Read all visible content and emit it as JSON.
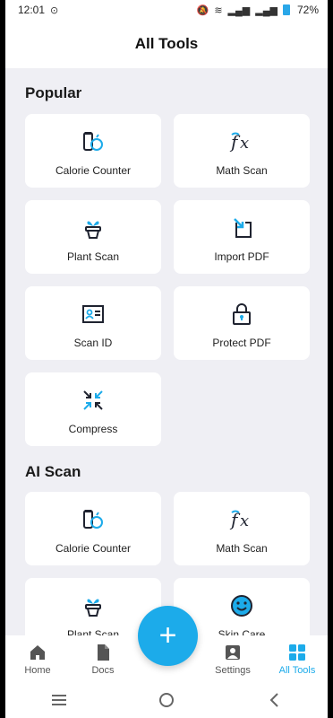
{
  "status": {
    "time": "12:01",
    "battery": "72%"
  },
  "header": {
    "title": "All Tools"
  },
  "sections": [
    {
      "title": "Popular",
      "items": [
        {
          "label": "Calorie Counter",
          "icon": "calorie-icon"
        },
        {
          "label": "Math Scan",
          "icon": "fx-icon"
        },
        {
          "label": "Plant Scan",
          "icon": "plant-icon"
        },
        {
          "label": "Import PDF",
          "icon": "import-icon"
        },
        {
          "label": "Scan ID",
          "icon": "id-card-icon"
        },
        {
          "label": "Protect PDF",
          "icon": "lock-icon"
        },
        {
          "label": "Compress",
          "icon": "compress-icon"
        }
      ]
    },
    {
      "title": "AI Scan",
      "items": [
        {
          "label": "Calorie Counter",
          "icon": "calorie-icon"
        },
        {
          "label": "Math Scan",
          "icon": "fx-icon"
        },
        {
          "label": "Plant Scan",
          "icon": "plant-icon"
        },
        {
          "label": "Skin Care",
          "icon": "smile-icon"
        }
      ]
    }
  ],
  "tabs": [
    {
      "label": "Home",
      "icon": "home-icon"
    },
    {
      "label": "Docs",
      "icon": "doc-icon"
    },
    {
      "label": "Settings",
      "icon": "settings-icon"
    },
    {
      "label": "All Tools",
      "icon": "grid-icon",
      "active": true
    }
  ],
  "fab": {
    "symbol": "+"
  },
  "colors": {
    "accent": "#1cabea",
    "background": "#efeff4",
    "icon_dark": "#1f2330"
  }
}
